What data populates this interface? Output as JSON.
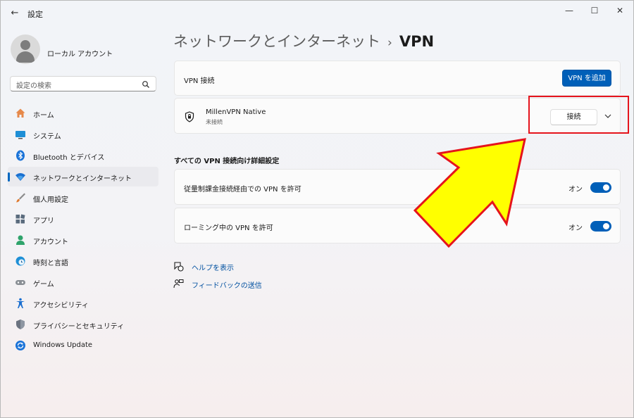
{
  "window": {
    "title": "設定",
    "controls": {
      "minimize": "—",
      "maximize": "☐",
      "close": "✕"
    }
  },
  "sidebar": {
    "profile_name": "ローカル アカウント",
    "search_placeholder": "設定の検索",
    "items": [
      {
        "label": "ホーム",
        "icon": "home-icon",
        "selected": false
      },
      {
        "label": "システム",
        "icon": "display-icon",
        "selected": false
      },
      {
        "label": "Bluetooth とデバイス",
        "icon": "bluetooth-icon",
        "selected": false
      },
      {
        "label": "ネットワークとインターネット",
        "icon": "wifi-icon",
        "selected": true
      },
      {
        "label": "個人用設定",
        "icon": "brush-icon",
        "selected": false
      },
      {
        "label": "アプリ",
        "icon": "apps-icon",
        "selected": false
      },
      {
        "label": "アカウント",
        "icon": "person-icon",
        "selected": false
      },
      {
        "label": "時刻と言語",
        "icon": "globe-clock-icon",
        "selected": false
      },
      {
        "label": "ゲーム",
        "icon": "gamepad-icon",
        "selected": false
      },
      {
        "label": "アクセシビリティ",
        "icon": "accessibility-icon",
        "selected": false
      },
      {
        "label": "プライバシーとセキュリティ",
        "icon": "shield-icon",
        "selected": false
      },
      {
        "label": "Windows Update",
        "icon": "update-icon",
        "selected": false
      }
    ]
  },
  "breadcrumb": {
    "parent": "ネットワークとインターネット",
    "separator": "›",
    "current": "VPN"
  },
  "vpn": {
    "header_label": "VPN 接続",
    "add_button": "VPN を追加",
    "connection": {
      "name": "MillenVPN Native",
      "status": "未接続",
      "connect_button": "接続"
    }
  },
  "advanced": {
    "heading": "すべての VPN 接続向け詳細設定",
    "settings": [
      {
        "label": "従量制課金接続経由での VPN を許可",
        "state": "オン",
        "on": true
      },
      {
        "label": "ローミング中の VPN を許可",
        "state": "オン",
        "on": true
      }
    ]
  },
  "links": {
    "help": "ヘルプを表示",
    "feedback": "フィードバックの送信"
  },
  "colors": {
    "accent": "#005fb8",
    "highlight_box": "#e5141c",
    "arrow_fill": "#ffff00",
    "arrow_stroke": "#e5141c"
  }
}
